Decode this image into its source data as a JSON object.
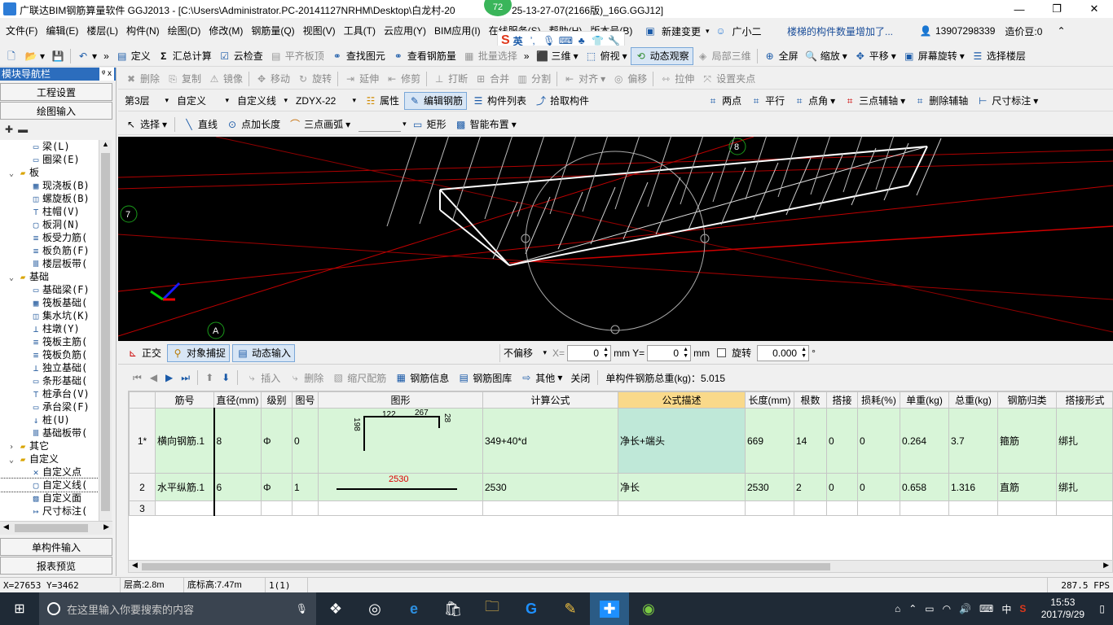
{
  "window": {
    "title": "广联达BIM钢筋算量软件 GGJ2013 - [C:\\Users\\Administrator.PC-20141127NRHM\\Desktop\\白龙村-20",
    "title_tail": "25-13-27-07(2166版)_16G.GGJ12]",
    "badge": "72"
  },
  "menu": [
    "文件(F)",
    "编辑(E)",
    "楼层(L)",
    "构件(N)",
    "绘图(D)",
    "修改(M)",
    "钢筋量(Q)",
    "视图(V)",
    "工具(T)",
    "云应用(Y)",
    "BIM应用(I)",
    "在线服务(S)",
    "帮助(H)",
    "版本号(B)"
  ],
  "menu_right": {
    "new_change": "新建变更",
    "xiaoer": "广小二",
    "notice": "楼梯的构件数量增加了...",
    "phone": "13907298339",
    "price_bean": "造价豆:0"
  },
  "ime": {
    "lang": "英"
  },
  "toolbar1": {
    "define": "定义",
    "sum": "汇总计算",
    "cloud_check": "云检查",
    "align_top": "平齐板顶",
    "find": "查找图元",
    "view_rebar": "查看钢筋量",
    "batch_select": "批量选择",
    "view_3d": "三维",
    "top_view": "俯视",
    "dynamic": "动态观察",
    "local_3d": "局部三维",
    "fullscreen": "全屏",
    "zoom": "缩放",
    "pan": "平移",
    "rotate_screen": "屏幕旋转",
    "select_floor": "选择楼层"
  },
  "toolbar2": [
    "删除",
    "复制",
    "镜像",
    "移动",
    "旋转",
    "延伸",
    "修剪",
    "打断",
    "合并",
    "分割",
    "对齐",
    "偏移",
    "拉伸",
    "设置夹点"
  ],
  "toolbar3": {
    "floor": "第3层",
    "type": "自定义",
    "subtype": "自定义线",
    "code": "ZDYX-22",
    "props": "属性",
    "edit_rebar": "编辑钢筋",
    "comp_list": "构件列表",
    "pick": "拾取构件",
    "two_points": "两点",
    "parallel": "平行",
    "point_angle": "点角",
    "three_point_axis": "三点辅轴",
    "del_axis": "删除辅轴",
    "dim": "尺寸标注"
  },
  "toolbar4": {
    "select": "选择",
    "line": "直线",
    "point_len": "点加长度",
    "arc": "三点画弧",
    "rect": "矩形",
    "smart": "智能布置"
  },
  "left_panel": {
    "header": "模块导航栏",
    "pin": "ᵠ x",
    "project_settings": "工程设置",
    "drawing_input": "绘图输入",
    "single_input": "单构件输入",
    "report": "报表预览",
    "tree": [
      {
        "indent": 3,
        "exp": "",
        "icon": "▭",
        "label": "梁(L)"
      },
      {
        "indent": 3,
        "exp": "",
        "icon": "▭",
        "label": "圈梁(E)"
      },
      {
        "indent": 1,
        "exp": "⌄",
        "icon": "▰",
        "label": "板"
      },
      {
        "indent": 3,
        "exp": "",
        "icon": "▦",
        "label": "现浇板(B)"
      },
      {
        "indent": 3,
        "exp": "",
        "icon": "◫",
        "label": "螺旋板(B)"
      },
      {
        "indent": 3,
        "exp": "",
        "icon": "⊤",
        "label": "柱帽(V)"
      },
      {
        "indent": 3,
        "exp": "",
        "icon": "▢",
        "label": "板洞(N)"
      },
      {
        "indent": 3,
        "exp": "",
        "icon": "≡",
        "label": "板受力筋("
      },
      {
        "indent": 3,
        "exp": "",
        "icon": "≡",
        "label": "板负筋(F)"
      },
      {
        "indent": 3,
        "exp": "",
        "icon": "Ⅲ",
        "label": "楼层板带("
      },
      {
        "indent": 1,
        "exp": "⌄",
        "icon": "▰",
        "label": "基础"
      },
      {
        "indent": 3,
        "exp": "",
        "icon": "▭",
        "label": "基础梁(F)"
      },
      {
        "indent": 3,
        "exp": "",
        "icon": "▦",
        "label": "筏板基础("
      },
      {
        "indent": 3,
        "exp": "",
        "icon": "◫",
        "label": "集水坑(K)"
      },
      {
        "indent": 3,
        "exp": "",
        "icon": "⊥",
        "label": "柱墩(Y)"
      },
      {
        "indent": 3,
        "exp": "",
        "icon": "≡",
        "label": "筏板主筋("
      },
      {
        "indent": 3,
        "exp": "",
        "icon": "≡",
        "label": "筏板负筋("
      },
      {
        "indent": 3,
        "exp": "",
        "icon": "⊥",
        "label": "独立基础("
      },
      {
        "indent": 3,
        "exp": "",
        "icon": "▭",
        "label": "条形基础("
      },
      {
        "indent": 3,
        "exp": "",
        "icon": "⊤",
        "label": "桩承台(V)"
      },
      {
        "indent": 3,
        "exp": "",
        "icon": "▭",
        "label": "承台梁(F)"
      },
      {
        "indent": 3,
        "exp": "",
        "icon": "↓",
        "label": "桩(U)"
      },
      {
        "indent": 3,
        "exp": "",
        "icon": "Ⅲ",
        "label": "基础板带("
      },
      {
        "indent": 1,
        "exp": "›",
        "icon": "▰",
        "label": "其它"
      },
      {
        "indent": 1,
        "exp": "⌄",
        "icon": "▰",
        "label": "自定义"
      },
      {
        "indent": 3,
        "exp": "",
        "icon": "✕",
        "label": "自定义点"
      },
      {
        "indent": 3,
        "exp": "",
        "icon": "▢",
        "label": "自定义线("
      },
      {
        "indent": 3,
        "exp": "",
        "icon": "▨",
        "label": "自定义面"
      },
      {
        "indent": 3,
        "exp": "",
        "icon": "↦",
        "label": "尺寸标注("
      }
    ]
  },
  "viewport": {
    "axis_labels": [
      "7",
      "A",
      "8"
    ]
  },
  "snapbar": {
    "ortho": "正交",
    "snap": "对象捕捉",
    "dyn_input": "动态输入",
    "offset_mode": "不偏移",
    "x_label": "X=",
    "x_val": "0",
    "y_label": "Y=",
    "y_val": "0",
    "unit": "mm",
    "rotate": "旋转",
    "rotate_val": "0.000",
    "deg": "°"
  },
  "rebar_toolbar": {
    "insert": "插入",
    "delete": "删除",
    "scale_rebar": "缩尺配筋",
    "rebar_info": "钢筋信息",
    "rebar_lib": "钢筋图库",
    "other": "其他",
    "close": "关闭",
    "total": "单构件钢筋总重(kg)：5.015"
  },
  "rebar_table": {
    "headers": [
      "",
      "筋号",
      "直径(mm)",
      "级别",
      "图号",
      "图形",
      "计算公式",
      "公式描述",
      "长度(mm)",
      "根数",
      "搭接",
      "损耗(%)",
      "单重(kg)",
      "总重(kg)",
      "钢筋归类",
      "搭接形式"
    ],
    "rows": [
      {
        "no": "1*",
        "name": "横向钢筋.1",
        "dia": "8",
        "grade": "Φ",
        "fig": "0",
        "formula": "349+40*d",
        "desc": "净长+端头",
        "length": "669",
        "count": "14",
        "lap": "0",
        "loss": "0",
        "unit_w": "0.264",
        "total_w": "3.7",
        "cat": "箍筋",
        "lap_type": "绑扎",
        "shape": {
          "a": "198",
          "b": "122",
          "c": "267",
          "d": "28"
        }
      },
      {
        "no": "2",
        "name": "水平纵筋.1",
        "dia": "6",
        "grade": "Φ",
        "fig": "1",
        "formula": "2530",
        "desc": "净长",
        "length": "2530",
        "count": "2",
        "lap": "0",
        "loss": "0",
        "unit_w": "0.658",
        "total_w": "1.316",
        "cat": "直筋",
        "lap_type": "绑扎",
        "shape": {
          "a": "2530"
        }
      },
      {
        "no": "3",
        "name": "",
        "dia": "",
        "grade": "",
        "fig": "",
        "formula": "",
        "desc": "",
        "length": "",
        "count": "",
        "lap": "",
        "loss": "",
        "unit_w": "",
        "total_w": "",
        "cat": "",
        "lap_type": "",
        "shape": {}
      }
    ]
  },
  "status": {
    "coords": "X=27653 Y=3462",
    "floor_h": "层高:2.8m",
    "base_h": "底标高:7.47m",
    "count": "1(1)",
    "fps": "287.5 FPS"
  },
  "taskbar": {
    "search_placeholder": "在这里输入你要搜索的内容",
    "ime": "中",
    "time": "15:53",
    "date": "2017/9/29"
  }
}
